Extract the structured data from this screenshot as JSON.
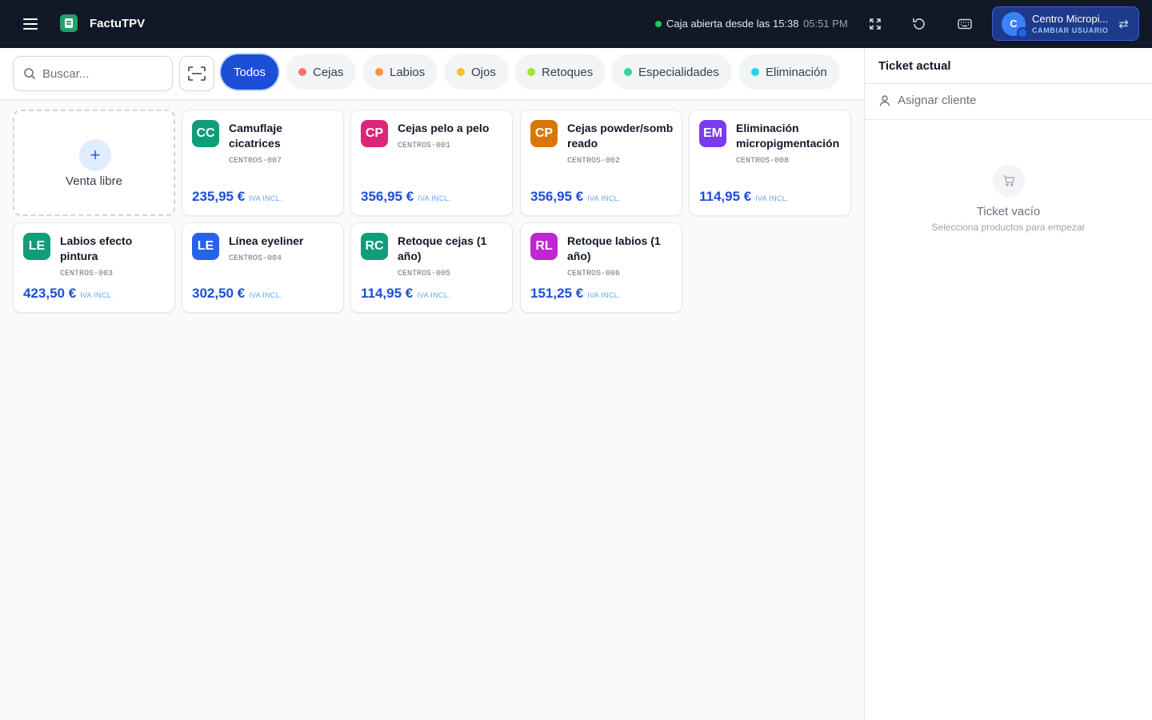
{
  "app": {
    "name": "FactuTPV",
    "accent": "#1d4ed8",
    "topbar_bg": "#111827"
  },
  "header": {
    "status_text": "Caja abierta desde las 15:38",
    "clock": "05:51 PM",
    "icons": [
      "fullscreen-icon",
      "refresh-icon",
      "keyboard-icon"
    ],
    "user": {
      "initial": "C",
      "name": "Centro Micropi...",
      "action": "CAMBIAR USUARIO"
    }
  },
  "search": {
    "placeholder": "Buscar...",
    "value": ""
  },
  "categories": [
    {
      "label": "Todos",
      "active": true
    },
    {
      "label": "Cejas",
      "color": "#f87171"
    },
    {
      "label": "Labios",
      "color": "#fb923c"
    },
    {
      "label": "Ojos",
      "color": "#fbbf24"
    },
    {
      "label": "Retoques",
      "color": "#a3e635"
    },
    {
      "label": "Especialidades",
      "color": "#34d399"
    },
    {
      "label": "Eliminación",
      "color": "#22d3ee"
    }
  ],
  "free_sale": {
    "label": "Venta libre"
  },
  "tax_label": "IVA INCL.",
  "products": [
    {
      "initials": "CC",
      "name": "Camuflaje cicatrices",
      "code": "CENTROS-007",
      "price": "235,95 €",
      "color": "#0f9d7a"
    },
    {
      "initials": "CP",
      "name": "Cejas pelo a pelo",
      "code": "CENTROS-001",
      "price": "356,95 €",
      "color": "#db2777"
    },
    {
      "initials": "CP",
      "name": "Cejas powder/sombreado",
      "code": "CENTROS-002",
      "price": "356,95 €",
      "color": "#d97706"
    },
    {
      "initials": "EM",
      "name": "Eliminación micropigmentación",
      "code": "CENTROS-008",
      "price": "114,95 €",
      "color": "#7c3aed"
    },
    {
      "initials": "LE",
      "name": "Labios efecto pintura",
      "code": "CENTROS-003",
      "price": "423,50 €",
      "color": "#0f9d7a"
    },
    {
      "initials": "LE",
      "name": "Línea eyeliner",
      "code": "CENTROS-004",
      "price": "302,50 €",
      "color": "#2563eb"
    },
    {
      "initials": "RC",
      "name": "Retoque cejas (1 año)",
      "code": "CENTROS-005",
      "price": "114,95 €",
      "color": "#0f9d7a"
    },
    {
      "initials": "RL",
      "name": "Retoque labios (1 año)",
      "code": "CENTROS-006",
      "price": "151,25 €",
      "color": "#c026d3"
    }
  ],
  "ticket": {
    "title": "Ticket actual",
    "assign_label": "Asignar cliente",
    "empty_title": "Ticket vacío",
    "empty_subtitle": "Selecciona productos para empezar"
  }
}
